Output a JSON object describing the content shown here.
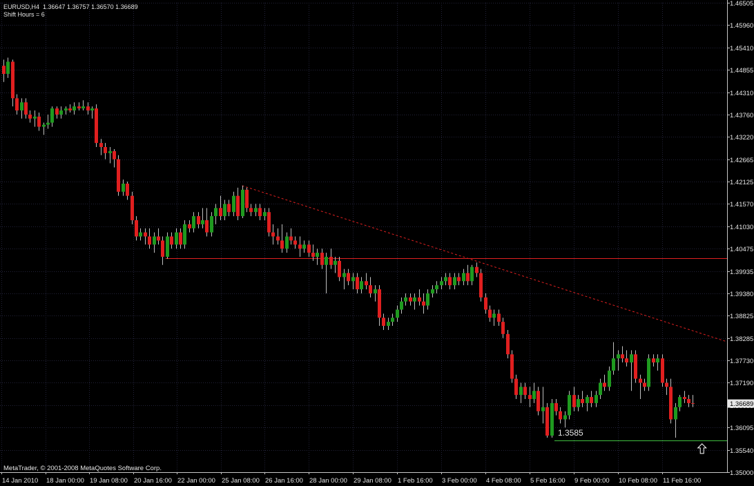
{
  "header": {
    "line1": "EURUSD,H4  1.36647 1.36757 1.36570 1.36689",
    "line2": "Shift Hours = 6"
  },
  "footer": {
    "copyright": "MetaTrader, © 2001-2008 MetaQuotes Software Corp."
  },
  "colors": {
    "background": "#000000",
    "grid": "#23233a",
    "axis": "#c8c8c8",
    "bull": "#1f9a1f",
    "bear": "#e01f1f",
    "wick": "#c0c0c0",
    "resistance": "#e02020",
    "support": "#40c040",
    "trendline": "#e02020"
  },
  "chart_data": {
    "type": "candlestick",
    "symbol": "EURUSD",
    "timeframe": "H4",
    "ylim": [
      1.35,
      1.4655
    ],
    "y_ticks": [
      "1.46505",
      "1.45960",
      "1.45410",
      "1.44855",
      "1.44310",
      "1.43760",
      "1.43220",
      "1.42665",
      "1.42125",
      "1.41570",
      "1.41030",
      "1.40475",
      "1.39935",
      "1.39380",
      "1.38825",
      "1.38285",
      "1.37730",
      "1.37190",
      "1.36635",
      "1.36095",
      "1.35540",
      "1.35000"
    ],
    "x_ticks": [
      "14 Jan 2010",
      "18 Jan 00:00",
      "19 Jan 08:00",
      "20 Jan 16:00",
      "22 Jan 00:00",
      "25 Jan 08:00",
      "26 Jan 16:00",
      "28 Jan 00:00",
      "29 Jan 08:00",
      "1 Feb 16:00",
      "3 Feb 00:00",
      "4 Feb 08:00",
      "5 Feb 16:00",
      "9 Feb 00:00",
      "10 Feb 08:00",
      "11 Feb 16:00"
    ],
    "current_price": "1.36689",
    "annotations": [
      {
        "type": "text",
        "text": "1.3585",
        "index": 125,
        "price": 1.3585
      },
      {
        "type": "arrow",
        "direction": "up",
        "index": 158,
        "price": 1.3558
      }
    ],
    "horizontal_lines": [
      {
        "name": "resistance",
        "price": 1.4027,
        "from_index": 37
      },
      {
        "name": "support",
        "price": 1.3578,
        "from_index": 125
      }
    ],
    "trend_line": {
      "from": {
        "index": 54,
        "price": 1.4205
      },
      "to": {
        "index": 108,
        "price": 1.4016
      }
    },
    "ohlc": [
      [
        1.45,
        1.4515,
        1.446,
        1.448
      ],
      [
        1.448,
        1.452,
        1.447,
        1.451
      ],
      [
        1.451,
        1.4515,
        1.44,
        1.442
      ],
      [
        1.442,
        1.443,
        1.438,
        1.439
      ],
      [
        1.439,
        1.442,
        1.437,
        1.441
      ],
      [
        1.441,
        1.442,
        1.437,
        1.438
      ],
      [
        1.438,
        1.439,
        1.436,
        1.437
      ],
      [
        1.437,
        1.439,
        1.435,
        1.4375
      ],
      [
        1.4375,
        1.4385,
        1.434,
        1.435
      ],
      [
        1.435,
        1.436,
        1.433,
        1.4355
      ],
      [
        1.4355,
        1.438,
        1.4345,
        1.436
      ],
      [
        1.436,
        1.44,
        1.435,
        1.4395
      ],
      [
        1.4395,
        1.44,
        1.437,
        1.438
      ],
      [
        1.438,
        1.44,
        1.437,
        1.439
      ],
      [
        1.439,
        1.44,
        1.438,
        1.4395
      ],
      [
        1.4395,
        1.4405,
        1.4385,
        1.439
      ],
      [
        1.439,
        1.441,
        1.438,
        1.44
      ],
      [
        1.44,
        1.441,
        1.439,
        1.4395
      ],
      [
        1.4395,
        1.4415,
        1.439,
        1.44
      ],
      [
        1.44,
        1.441,
        1.438,
        1.439
      ],
      [
        1.439,
        1.44,
        1.437,
        1.4395
      ],
      [
        1.4395,
        1.4405,
        1.43,
        1.431
      ],
      [
        1.431,
        1.432,
        1.428,
        1.43
      ],
      [
        1.43,
        1.431,
        1.427,
        1.4285
      ],
      [
        1.4285,
        1.43,
        1.426,
        1.429
      ],
      [
        1.429,
        1.4295,
        1.425,
        1.427
      ],
      [
        1.427,
        1.428,
        1.418,
        1.419
      ],
      [
        1.419,
        1.422,
        1.418,
        1.421
      ],
      [
        1.421,
        1.4215,
        1.417,
        1.418
      ],
      [
        1.418,
        1.419,
        1.411,
        1.412
      ],
      [
        1.412,
        1.413,
        1.407,
        1.408
      ],
      [
        1.408,
        1.41,
        1.407,
        1.409
      ],
      [
        1.409,
        1.41,
        1.406,
        1.408
      ],
      [
        1.408,
        1.41,
        1.405,
        1.406
      ],
      [
        1.406,
        1.409,
        1.404,
        1.408
      ],
      [
        1.408,
        1.41,
        1.406,
        1.407
      ],
      [
        1.407,
        1.408,
        1.401,
        1.403
      ],
      [
        1.403,
        1.409,
        1.4025,
        1.408
      ],
      [
        1.408,
        1.409,
        1.405,
        1.406
      ],
      [
        1.406,
        1.41,
        1.405,
        1.409
      ],
      [
        1.409,
        1.41,
        1.405,
        1.406
      ],
      [
        1.406,
        1.412,
        1.405,
        1.411
      ],
      [
        1.411,
        1.412,
        1.409,
        1.41
      ],
      [
        1.41,
        1.414,
        1.409,
        1.413
      ],
      [
        1.413,
        1.414,
        1.41,
        1.411
      ],
      [
        1.411,
        1.415,
        1.41,
        1.412
      ],
      [
        1.412,
        1.415,
        1.408,
        1.409
      ],
      [
        1.409,
        1.414,
        1.408,
        1.413
      ],
      [
        1.413,
        1.416,
        1.411,
        1.415
      ],
      [
        1.415,
        1.418,
        1.412,
        1.413
      ],
      [
        1.413,
        1.417,
        1.412,
        1.416
      ],
      [
        1.416,
        1.417,
        1.413,
        1.414
      ],
      [
        1.414,
        1.419,
        1.413,
        1.418
      ],
      [
        1.418,
        1.42,
        1.412,
        1.413
      ],
      [
        1.413,
        1.4205,
        1.4125,
        1.4195
      ],
      [
        1.4195,
        1.42,
        1.414,
        1.415
      ],
      [
        1.415,
        1.416,
        1.413,
        1.414
      ],
      [
        1.414,
        1.416,
        1.413,
        1.415
      ],
      [
        1.415,
        1.416,
        1.412,
        1.413
      ],
      [
        1.413,
        1.415,
        1.412,
        1.414
      ],
      [
        1.414,
        1.415,
        1.408,
        1.409
      ],
      [
        1.409,
        1.411,
        1.406,
        1.408
      ],
      [
        1.408,
        1.41,
        1.406,
        1.407
      ],
      [
        1.407,
        1.411,
        1.404,
        1.405
      ],
      [
        1.405,
        1.409,
        1.404,
        1.408
      ],
      [
        1.408,
        1.41,
        1.406,
        1.407
      ],
      [
        1.407,
        1.408,
        1.405,
        1.406
      ],
      [
        1.406,
        1.408,
        1.403,
        1.405
      ],
      [
        1.405,
        1.407,
        1.404,
        1.406
      ],
      [
        1.406,
        1.407,
        1.403,
        1.404
      ],
      [
        1.404,
        1.406,
        1.402,
        1.403
      ],
      [
        1.403,
        1.405,
        1.401,
        1.404
      ],
      [
        1.404,
        1.405,
        1.4,
        1.401
      ],
      [
        1.401,
        1.404,
        1.394,
        1.403
      ],
      [
        1.403,
        1.405,
        1.4,
        1.401
      ],
      [
        1.401,
        1.403,
        1.399,
        1.402
      ],
      [
        1.402,
        1.403,
        1.397,
        1.398
      ],
      [
        1.398,
        1.4,
        1.395,
        1.399
      ],
      [
        1.399,
        1.4,
        1.396,
        1.397
      ],
      [
        1.397,
        1.399,
        1.395,
        1.398
      ],
      [
        1.398,
        1.399,
        1.394,
        1.395
      ],
      [
        1.395,
        1.398,
        1.394,
        1.397
      ],
      [
        1.397,
        1.399,
        1.395,
        1.396
      ],
      [
        1.396,
        1.398,
        1.393,
        1.394
      ],
      [
        1.394,
        1.396,
        1.392,
        1.395
      ],
      [
        1.395,
        1.396,
        1.386,
        1.388
      ],
      [
        1.388,
        1.389,
        1.385,
        1.386
      ],
      [
        1.386,
        1.388,
        1.385,
        1.387
      ],
      [
        1.387,
        1.389,
        1.386,
        1.388
      ],
      [
        1.388,
        1.391,
        1.387,
        1.39
      ],
      [
        1.39,
        1.393,
        1.389,
        1.392
      ],
      [
        1.392,
        1.394,
        1.391,
        1.393
      ],
      [
        1.393,
        1.394,
        1.391,
        1.392
      ],
      [
        1.392,
        1.394,
        1.39,
        1.393
      ],
      [
        1.393,
        1.395,
        1.391,
        1.392
      ],
      [
        1.392,
        1.394,
        1.389,
        1.391
      ],
      [
        1.391,
        1.395,
        1.39,
        1.394
      ],
      [
        1.394,
        1.396,
        1.393,
        1.395
      ],
      [
        1.395,
        1.397,
        1.394,
        1.396
      ],
      [
        1.396,
        1.398,
        1.395,
        1.397
      ],
      [
        1.397,
        1.399,
        1.396,
        1.398
      ],
      [
        1.398,
        1.399,
        1.395,
        1.396
      ],
      [
        1.396,
        1.399,
        1.395,
        1.398
      ],
      [
        1.398,
        1.399,
        1.396,
        1.397
      ],
      [
        1.397,
        1.4,
        1.396,
        1.399
      ],
      [
        1.399,
        1.401,
        1.396,
        1.397
      ],
      [
        1.397,
        1.401,
        1.396,
        1.4005
      ],
      [
        1.4005,
        1.4016,
        1.398,
        1.399
      ],
      [
        1.399,
        1.4,
        1.392,
        1.393
      ],
      [
        1.393,
        1.394,
        1.389,
        1.39
      ],
      [
        1.39,
        1.391,
        1.387,
        1.388
      ],
      [
        1.388,
        1.39,
        1.386,
        1.389
      ],
      [
        1.389,
        1.39,
        1.386,
        1.387
      ],
      [
        1.387,
        1.388,
        1.383,
        1.384
      ],
      [
        1.384,
        1.385,
        1.378,
        1.379
      ],
      [
        1.379,
        1.38,
        1.372,
        1.373
      ],
      [
        1.373,
        1.374,
        1.368,
        1.369
      ],
      [
        1.369,
        1.372,
        1.367,
        1.371
      ],
      [
        1.371,
        1.372,
        1.368,
        1.369
      ],
      [
        1.369,
        1.371,
        1.366,
        1.368
      ],
      [
        1.368,
        1.372,
        1.367,
        1.37
      ],
      [
        1.37,
        1.371,
        1.364,
        1.365
      ],
      [
        1.365,
        1.371,
        1.362,
        1.366
      ],
      [
        1.366,
        1.367,
        1.3585,
        1.359
      ],
      [
        1.359,
        1.368,
        1.3585,
        1.367
      ],
      [
        1.367,
        1.368,
        1.364,
        1.365
      ],
      [
        1.365,
        1.366,
        1.362,
        1.363
      ],
      [
        1.363,
        1.365,
        1.361,
        1.364
      ],
      [
        1.364,
        1.37,
        1.363,
        1.369
      ],
      [
        1.369,
        1.371,
        1.365,
        1.366
      ],
      [
        1.366,
        1.369,
        1.365,
        1.368
      ],
      [
        1.368,
        1.37,
        1.366,
        1.367
      ],
      [
        1.367,
        1.369,
        1.365,
        1.3685
      ],
      [
        1.3685,
        1.37,
        1.366,
        1.367
      ],
      [
        1.367,
        1.37,
        1.366,
        1.369
      ],
      [
        1.369,
        1.373,
        1.368,
        1.372
      ],
      [
        1.372,
        1.374,
        1.37,
        1.371
      ],
      [
        1.371,
        1.376,
        1.37,
        1.375
      ],
      [
        1.375,
        1.382,
        1.374,
        1.378
      ],
      [
        1.378,
        1.38,
        1.375,
        1.379
      ],
      [
        1.379,
        1.381,
        1.377,
        1.378
      ],
      [
        1.378,
        1.38,
        1.376,
        1.377
      ],
      [
        1.377,
        1.38,
        1.37,
        1.379
      ],
      [
        1.379,
        1.38,
        1.372,
        1.373
      ],
      [
        1.373,
        1.374,
        1.368,
        1.372
      ],
      [
        1.372,
        1.373,
        1.37,
        1.371
      ],
      [
        1.371,
        1.379,
        1.37,
        1.378
      ],
      [
        1.378,
        1.379,
        1.376,
        1.377
      ],
      [
        1.377,
        1.379,
        1.375,
        1.378
      ],
      [
        1.378,
        1.379,
        1.371,
        1.372
      ],
      [
        1.372,
        1.373,
        1.369,
        1.371
      ],
      [
        1.371,
        1.373,
        1.362,
        1.363
      ],
      [
        1.363,
        1.367,
        1.3585,
        1.366
      ],
      [
        1.366,
        1.369,
        1.365,
        1.3685
      ],
      [
        1.3685,
        1.37,
        1.367,
        1.368
      ],
      [
        1.368,
        1.369,
        1.366,
        1.367
      ],
      [
        1.367,
        1.369,
        1.366,
        1.36689
      ]
    ]
  }
}
